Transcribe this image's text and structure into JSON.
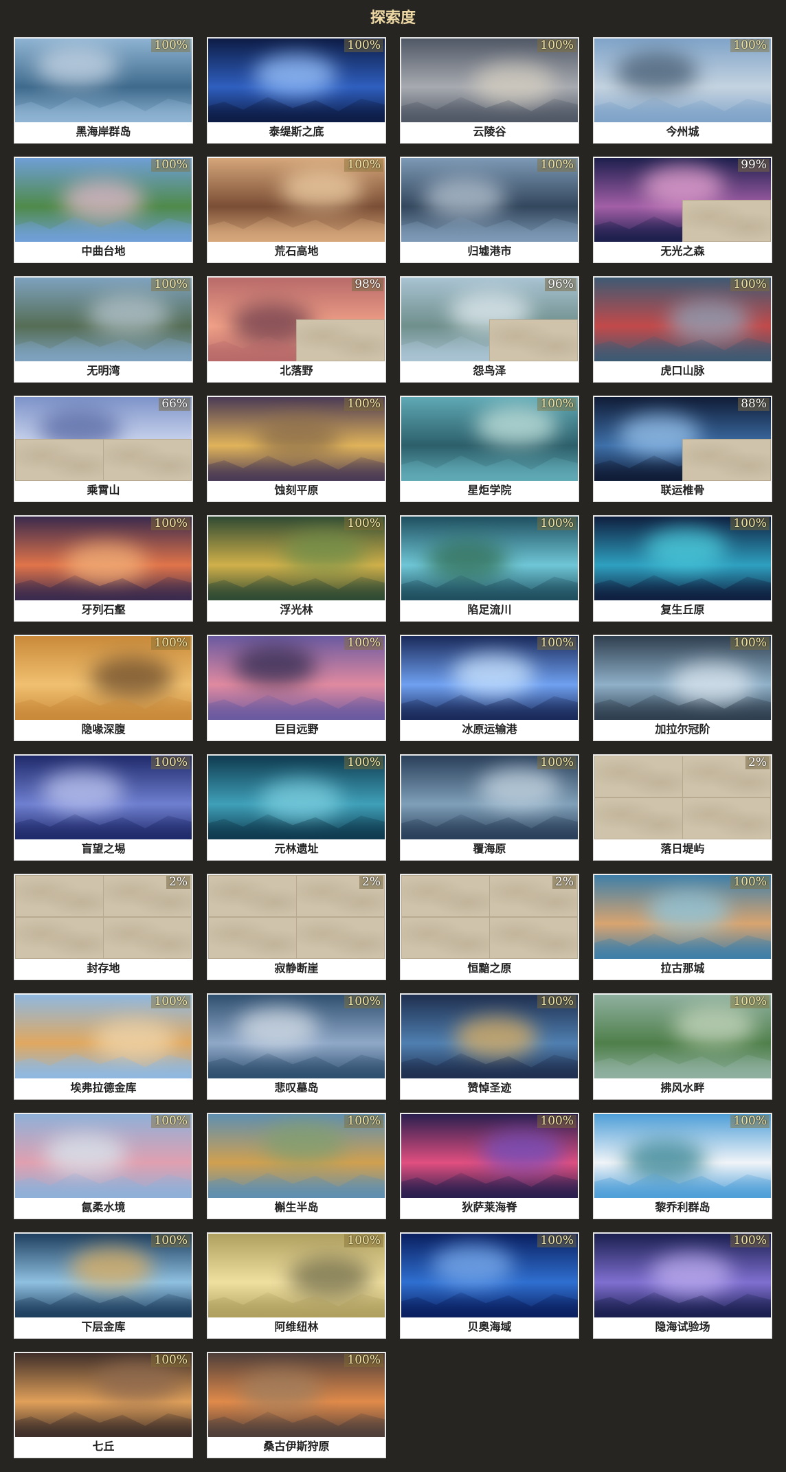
{
  "title": "探索度",
  "regions": [
    {
      "name": "黑海岸群岛",
      "progress": "100%",
      "fill": 1.0,
      "colors": [
        "#8fb4d3",
        "#3f6a8c",
        "#c9d7e6"
      ],
      "masked": []
    },
    {
      "name": "泰缇斯之底",
      "progress": "100%",
      "fill": 1.0,
      "colors": [
        "#0d1c45",
        "#2f5fbf",
        "#9fc8ff"
      ],
      "masked": []
    },
    {
      "name": "云陵谷",
      "progress": "100%",
      "fill": 1.0,
      "colors": [
        "#505866",
        "#a7aab0",
        "#d7d0c2"
      ],
      "masked": []
    },
    {
      "name": "今州城",
      "progress": "100%",
      "fill": 1.0,
      "colors": [
        "#7fa3c8",
        "#c4d3e0",
        "#445a70"
      ],
      "masked": []
    },
    {
      "name": "中曲台地",
      "progress": "100%",
      "fill": 1.0,
      "colors": [
        "#6f9fd6",
        "#4f8a4a",
        "#e6b9d0"
      ],
      "masked": []
    },
    {
      "name": "荒石高地",
      "progress": "100%",
      "fill": 1.0,
      "colors": [
        "#d5a67a",
        "#7a4e35",
        "#f2d2a7"
      ],
      "masked": []
    },
    {
      "name": "归墟港市",
      "progress": "100%",
      "fill": 1.0,
      "colors": [
        "#7d99b5",
        "#33475d",
        "#b8c6d4"
      ],
      "masked": []
    },
    {
      "name": "无光之森",
      "progress": "99%",
      "fill": 0.99,
      "colors": [
        "#1d1f4d",
        "#a25fa6",
        "#e9a7d3"
      ],
      "masked": [
        "br"
      ]
    },
    {
      "name": "无明湾",
      "progress": "100%",
      "fill": 1.0,
      "colors": [
        "#7ea2bf",
        "#556d55",
        "#b7c6cf"
      ],
      "masked": []
    },
    {
      "name": "北落野",
      "progress": "98%",
      "fill": 0.98,
      "colors": [
        "#b86a6a",
        "#f0a087",
        "#6a3a4a"
      ],
      "masked": [
        "br"
      ]
    },
    {
      "name": "怨鸟泽",
      "progress": "96%",
      "fill": 0.96,
      "colors": [
        "#a9c3d3",
        "#6f8f8c",
        "#e3edf2"
      ],
      "masked": [
        "br"
      ]
    },
    {
      "name": "虎口山脉",
      "progress": "100%",
      "fill": 1.0,
      "colors": [
        "#3d5a73",
        "#c24a4a",
        "#8aa6bd"
      ],
      "masked": []
    },
    {
      "name": "乘霄山",
      "progress": "66%",
      "fill": 0.66,
      "colors": [
        "#7d93c9",
        "#cfd8ef",
        "#5768a4"
      ],
      "masked": [
        "bl",
        "br"
      ]
    },
    {
      "name": "蚀刻平原",
      "progress": "100%",
      "fill": 1.0,
      "colors": [
        "#4a3a55",
        "#e0b35a",
        "#8a6d4a"
      ],
      "masked": []
    },
    {
      "name": "星炬学院",
      "progress": "100%",
      "fill": 1.0,
      "colors": [
        "#5fa9b5",
        "#2c5f6a",
        "#c8e6e0"
      ],
      "masked": []
    },
    {
      "name": "联运椎骨",
      "progress": "88%",
      "fill": 0.88,
      "colors": [
        "#101c36",
        "#3d6fa8",
        "#9cc7f0"
      ],
      "masked": [
        "br"
      ]
    },
    {
      "name": "牙列石壑",
      "progress": "100%",
      "fill": 1.0,
      "colors": [
        "#3a2a4d",
        "#e0744a",
        "#f2b27a"
      ],
      "masked": []
    },
    {
      "name": "浮光林",
      "progress": "100%",
      "fill": 1.0,
      "colors": [
        "#2f4a33",
        "#d0b04a",
        "#6f8f4a"
      ],
      "masked": []
    },
    {
      "name": "陷足流川",
      "progress": "100%",
      "fill": 1.0,
      "colors": [
        "#1f4f5f",
        "#6fc6d6",
        "#2f6a4f"
      ],
      "masked": []
    },
    {
      "name": "复生丘原",
      "progress": "100%",
      "fill": 1.0,
      "colors": [
        "#0f1f3f",
        "#2fa0c0",
        "#4fd0e0"
      ],
      "masked": []
    },
    {
      "name": "隐喙深腹",
      "progress": "100%",
      "fill": 1.0,
      "colors": [
        "#c98a3a",
        "#f0c070",
        "#6a4a2a"
      ],
      "masked": []
    },
    {
      "name": "巨目远野",
      "progress": "100%",
      "fill": 1.0,
      "colors": [
        "#6a5aa0",
        "#e08aa0",
        "#2f2a4f"
      ],
      "masked": []
    },
    {
      "name": "冰原运输港",
      "progress": "100%",
      "fill": 1.0,
      "colors": [
        "#1a2a5a",
        "#6fa0f0",
        "#d0e8ff"
      ],
      "masked": []
    },
    {
      "name": "加拉尔冠阶",
      "progress": "100%",
      "fill": 1.0,
      "colors": [
        "#2f3f4f",
        "#8fb0c8",
        "#dfe8f0"
      ],
      "masked": []
    },
    {
      "name": "盲望之埸",
      "progress": "100%",
      "fill": 1.0,
      "colors": [
        "#1f2a6a",
        "#6f7fd0",
        "#c0c8f0"
      ],
      "masked": []
    },
    {
      "name": "元林遗址",
      "progress": "100%",
      "fill": 1.0,
      "colors": [
        "#0f3a4f",
        "#3fa0b8",
        "#7fd0e0"
      ],
      "masked": []
    },
    {
      "name": "覆海原",
      "progress": "100%",
      "fill": 1.0,
      "colors": [
        "#2a3f5a",
        "#7f9fb8",
        "#c8d8e4"
      ],
      "masked": []
    },
    {
      "name": "落日堤屿",
      "progress": "2%",
      "fill": 0.02,
      "colors": [
        "#cfc3ab",
        "#cfc3ab",
        "#cfc3ab"
      ],
      "masked": [
        "tl",
        "tr",
        "bl",
        "br"
      ]
    },
    {
      "name": "封存地",
      "progress": "2%",
      "fill": 0.02,
      "colors": [
        "#cfc3ab",
        "#cfc3ab",
        "#cfc3ab"
      ],
      "masked": [
        "tl",
        "tr",
        "bl",
        "br"
      ]
    },
    {
      "name": "寂静断崖",
      "progress": "2%",
      "fill": 0.02,
      "colors": [
        "#cfc3ab",
        "#cfc3ab",
        "#cfc3ab"
      ],
      "masked": [
        "tl",
        "tr",
        "bl",
        "br"
      ]
    },
    {
      "name": "恒黯之原",
      "progress": "2%",
      "fill": 0.02,
      "colors": [
        "#cfc3ab",
        "#cfc3ab",
        "#cfc3ab"
      ],
      "masked": [
        "tl",
        "tr",
        "bl",
        "br"
      ]
    },
    {
      "name": "拉古那城",
      "progress": "100%",
      "fill": 1.0,
      "colors": [
        "#3f7fa8",
        "#d8a470",
        "#8fc8e0"
      ],
      "masked": []
    },
    {
      "name": "埃弗拉德金库",
      "progress": "100%",
      "fill": 1.0,
      "colors": [
        "#8fb8e0",
        "#e0a860",
        "#f0d8b0"
      ],
      "masked": []
    },
    {
      "name": "悲叹墓岛",
      "progress": "100%",
      "fill": 1.0,
      "colors": [
        "#2f4f6f",
        "#8fa8c8",
        "#d8e0e8"
      ],
      "masked": []
    },
    {
      "name": "赞悼圣迹",
      "progress": "100%",
      "fill": 1.0,
      "colors": [
        "#1f2f4f",
        "#4f7fb0",
        "#e0b060"
      ],
      "masked": []
    },
    {
      "name": "拂风水畔",
      "progress": "100%",
      "fill": 1.0,
      "colors": [
        "#8fb0a0",
        "#4f7f4a",
        "#c8d8c0"
      ],
      "masked": []
    },
    {
      "name": "氤柔水境",
      "progress": "100%",
      "fill": 1.0,
      "colors": [
        "#8fb0d8",
        "#e0a0b0",
        "#d8e8f0"
      ],
      "masked": []
    },
    {
      "name": "槲生半岛",
      "progress": "100%",
      "fill": 1.0,
      "colors": [
        "#5f8fb0",
        "#d0a050",
        "#7f9f6f"
      ],
      "masked": []
    },
    {
      "name": "狄萨莱海脊",
      "progress": "100%",
      "fill": 1.0,
      "colors": [
        "#2a1f4f",
        "#e04f7f",
        "#6f4fc0"
      ],
      "masked": []
    },
    {
      "name": "黎乔利群岛",
      "progress": "100%",
      "fill": 1.0,
      "colors": [
        "#4f9fd8",
        "#f0f4f8",
        "#2f7f8f"
      ],
      "masked": []
    },
    {
      "name": "下层金库",
      "progress": "100%",
      "fill": 1.0,
      "colors": [
        "#1f3f5f",
        "#8fc0e0",
        "#e0b060"
      ],
      "masked": []
    },
    {
      "name": "阿维纽林",
      "progress": "100%",
      "fill": 1.0,
      "colors": [
        "#b0a060",
        "#f0e0a0",
        "#6f6a4a"
      ],
      "masked": []
    },
    {
      "name": "贝奥海域",
      "progress": "100%",
      "fill": 1.0,
      "colors": [
        "#0a1f5f",
        "#2f6fd0",
        "#7fb0f0"
      ],
      "masked": []
    },
    {
      "name": "隐海试验场",
      "progress": "100%",
      "fill": 1.0,
      "colors": [
        "#1a1f4f",
        "#7f6fd0",
        "#c0b0f0"
      ],
      "masked": []
    },
    {
      "name": "七丘",
      "progress": "100%",
      "fill": 1.0,
      "colors": [
        "#3f2f2a",
        "#e0a05a",
        "#8f6a4f"
      ],
      "masked": []
    },
    {
      "name": "桑古伊斯狩原",
      "progress": "100%",
      "fill": 1.0,
      "colors": [
        "#4f3f3a",
        "#e08a4a",
        "#a07f5f"
      ],
      "masked": []
    }
  ]
}
